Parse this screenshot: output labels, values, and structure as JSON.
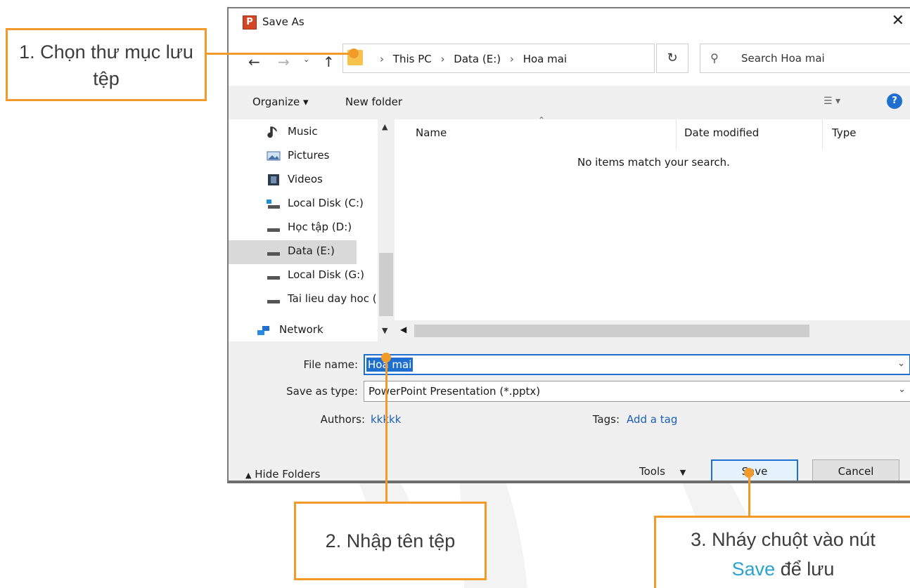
{
  "dialog": {
    "title": "Save As",
    "close_glyph": "✕",
    "app_icon_letter": "P",
    "nav": {
      "back_icon": "arrow-left-icon",
      "forward_icon": "arrow-right-icon",
      "up_icon": "arrow-up-icon",
      "breadcrumbs": [
        "This PC",
        "Data (E:)",
        "Hoa mai"
      ],
      "search_placeholder": "Search Hoa mai"
    },
    "toolbar": {
      "organize_label": "Organize ▾",
      "new_folder_label": "New folder"
    },
    "sidebar": {
      "items": [
        {
          "label": "Music",
          "icon": "music-icon"
        },
        {
          "label": "Pictures",
          "icon": "pictures-icon"
        },
        {
          "label": "Videos",
          "icon": "videos-icon"
        },
        {
          "label": "Local Disk (C:)",
          "icon": "system-drive-icon"
        },
        {
          "label": "Học tập (D:)",
          "icon": "drive-icon"
        },
        {
          "label": "Data (E:)",
          "icon": "drive-icon",
          "selected": true
        },
        {
          "label": "Local Disk (G:)",
          "icon": "drive-icon"
        },
        {
          "label": "Tai lieu day hoc (",
          "icon": "drive-icon"
        },
        {
          "label": "Network",
          "icon": "network-icon"
        }
      ]
    },
    "files": {
      "columns": [
        "Name",
        "Date modified",
        "Type"
      ],
      "empty_message": "No items match your search."
    },
    "form": {
      "file_name_label": "File name:",
      "file_name_value": "Hoa mai",
      "save_type_label": "Save as type:",
      "save_type_value": "PowerPoint Presentation (*.pptx)",
      "authors_label": "Authors:",
      "authors_value": "kkkkk",
      "tags_label": "Tags:",
      "tags_value": "Add a tag"
    },
    "footer": {
      "hide_folders_label": "Hide Folders",
      "tools_label": "Tools",
      "save_label": "Save",
      "cancel_label": "Cancel"
    }
  },
  "annotations": {
    "step1": "1. Chọn thư mục lưu tệp",
    "step2": "2. Nhập tên tệp",
    "step3_text": "3. Nháy chuột vào nút",
    "step3_save": "Save",
    "step3_tail": "để lưu"
  },
  "colors": {
    "accent": "#1e6fd0",
    "callout_border": "#f29b2b",
    "link": "#1a5fb4",
    "save_highlight": "#2aa4cf"
  }
}
